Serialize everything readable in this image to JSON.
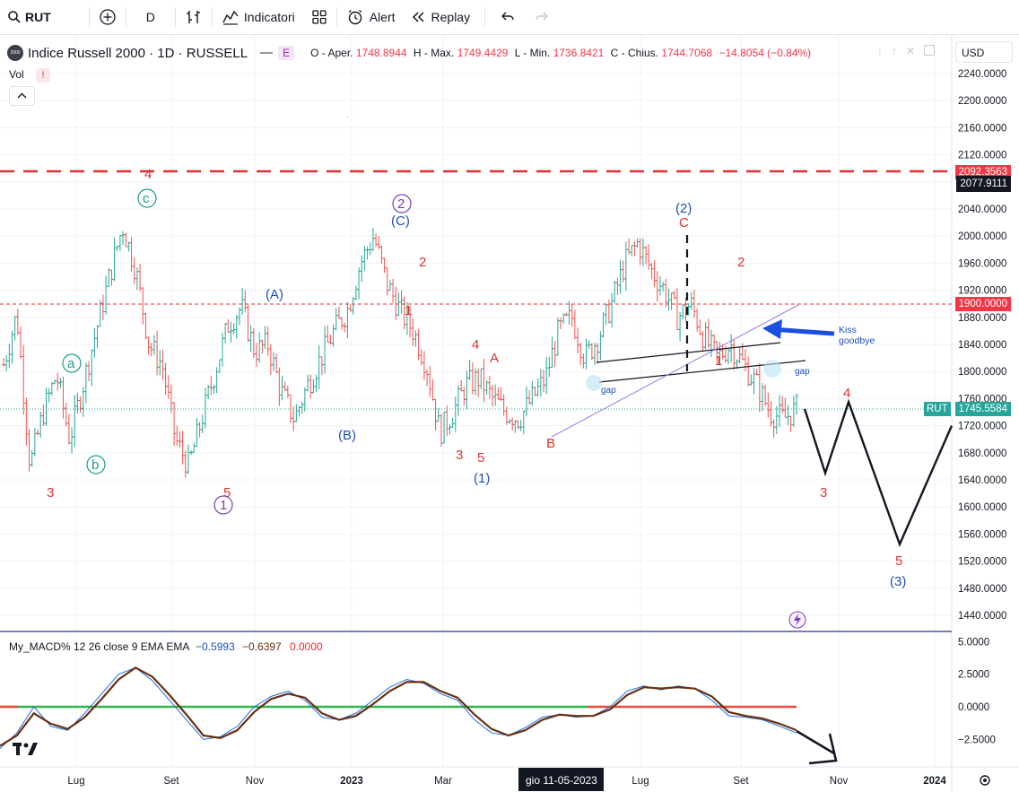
{
  "toolbar": {
    "symbol": "RUT",
    "interval": "D",
    "indicators_label": "Indicatori",
    "alert_label": "Alert",
    "replay_label": "Replay"
  },
  "legend": {
    "title": "Indice Russell 2000 · 1D · RUSSELL",
    "badge": "E",
    "o_label": "O - Aper.",
    "o_value": "1748.8944",
    "h_label": "H - Max.",
    "h_value": "1749.4429",
    "l_label": "L - Min.",
    "l_value": "1736.8421",
    "c_label": "C - Chius.",
    "c_value": "1744.7068",
    "change": "−14.8054 (−0.84%)",
    "vol_label": "Vol"
  },
  "currency": "USD",
  "price_tags": {
    "top_red": "2092.3563",
    "crosshair": "2077.9111",
    "level_1900": "1900.0000",
    "last_symbol": "RUT",
    "last_price": "1745.5584"
  },
  "annotations": {
    "kiss_line1": "Kiss",
    "kiss_line2": "goodbye",
    "gap1": "gap",
    "gap2": "gap"
  },
  "macd": {
    "label": "My_MACD% 12 26 close 9 EMA EMA",
    "v1": "−0.5993",
    "v2": "−0.6397",
    "v3": "0.0000"
  },
  "x_axis_highlight": "gio 11-05-2023",
  "colors": {
    "up": "#26a69a",
    "down": "#ef5350",
    "red_wave": "#e03131",
    "blue_wave": "#1e4fb8",
    "green_wave": "#1a9c8a",
    "purple_wave": "#7b3fb5",
    "macd_line": "#1e6fe0",
    "signal_line": "#6b2f0f"
  },
  "chart_data": {
    "type": "line",
    "title": "Indice Russell 2000 · 1D · RUSSELL",
    "y_axis": {
      "ticks": [
        2240,
        2200,
        2160,
        2120,
        2080,
        2040,
        2000,
        1960,
        1920,
        1880,
        1840,
        1800,
        1760,
        1720,
        1680,
        1640,
        1600,
        1560,
        1520,
        1480,
        1440
      ],
      "tick_labels": [
        "2240.0000",
        "2200.0000",
        "2160.0000",
        "2120.0000",
        "2080.0000",
        "2040.0000",
        "2000.0000",
        "1960.0000",
        "1920.0000",
        "1880.0000",
        "1840.0000",
        "1800.0000",
        "1760.0000",
        "1720.0000",
        "1680.0000",
        "1640.0000",
        "1600.0000",
        "1560.0000",
        "1520.0000",
        "1480.0000",
        "1440.0000"
      ],
      "ylim": [
        1420,
        2280
      ]
    },
    "x_axis": {
      "tick_labels": [
        "Lug",
        "Set",
        "Nov",
        "2023",
        "Mar",
        "Lug",
        "Set",
        "Nov",
        "2024"
      ]
    },
    "horizontal_levels": [
      2092.3563,
      1900.0
    ],
    "last_price": 1745.5584,
    "series": [
      {
        "values": [
          1810,
          1885,
          1660,
          1740,
          1795,
          1700,
          1780,
          1860,
          1940,
          2015,
          1950,
          1840,
          1810,
          1700,
          1660,
          1730,
          1800,
          1870,
          1895,
          1830,
          1840,
          1770,
          1730,
          1780,
          1820,
          1860,
          1890,
          1960,
          2000,
          1930,
          1890,
          1860,
          1810,
          1710,
          1740,
          1780,
          1790,
          1760,
          1740,
          1730,
          1760,
          1790,
          1860,
          1880,
          1820,
          1850,
          1900,
          1960,
          1990,
          1950,
          1920,
          1880,
          1900,
          1850,
          1820,
          1840,
          1810,
          1780,
          1740,
          1730,
          1745
        ]
      }
    ],
    "projection": {
      "values": [
        1745,
        1650,
        1755,
        1545,
        1720
      ]
    },
    "macd": {
      "y_axis": {
        "ticks": [
          5,
          2.5,
          0,
          -2.5
        ],
        "tick_labels": [
          "5.0000",
          "2.5000",
          "0.0000",
          "−2.5000"
        ],
        "ylim": [
          -3.5,
          5.5
        ]
      },
      "series": [
        {
          "values": [
            -3.2,
            -2.0,
            0.0,
            -1.5,
            -1.8,
            -0.5,
            1.0,
            2.5,
            3.0,
            2.0,
            0.5,
            -1.0,
            -2.5,
            -2.3,
            -1.5,
            0.0,
            0.8,
            1.2,
            0.5,
            -0.8,
            -1.0,
            -0.5,
            0.5,
            1.5,
            2.1,
            1.8,
            1.0,
            0.5,
            -1.0,
            -2.0,
            -2.2,
            -1.6,
            -0.8,
            -0.6,
            -0.8,
            -0.7,
            0.0,
            1.2,
            1.6,
            1.3,
            1.6,
            1.4,
            0.5,
            -0.7,
            -0.8,
            -1.0,
            -1.5,
            -2.0
          ]
        },
        {
          "values": [
            -3.0,
            -2.2,
            -0.5,
            -1.3,
            -1.7,
            -0.8,
            0.6,
            2.1,
            3.0,
            2.3,
            0.9,
            -0.6,
            -2.2,
            -2.4,
            -1.8,
            -0.4,
            0.6,
            1.0,
            0.7,
            -0.5,
            -1.0,
            -0.7,
            0.2,
            1.2,
            1.9,
            1.9,
            1.2,
            0.7,
            -0.6,
            -1.7,
            -2.2,
            -1.8,
            -1.0,
            -0.6,
            -0.7,
            -0.7,
            -0.2,
            0.9,
            1.5,
            1.4,
            1.5,
            1.4,
            0.8,
            -0.4,
            -0.7,
            -0.9,
            -1.3,
            -1.8
          ]
        }
      ],
      "zero_line_segments": [
        "positive",
        "negative"
      ]
    }
  }
}
